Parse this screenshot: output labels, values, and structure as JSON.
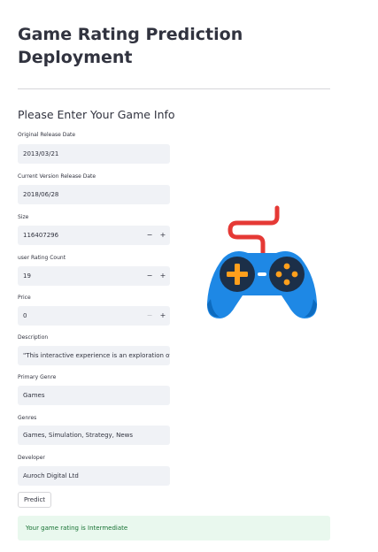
{
  "header": {
    "title": "Game Rating Prediction Deployment",
    "subheader": "Please Enter Your Game Info"
  },
  "form": {
    "original_release_date": {
      "label": "Original Release Date",
      "value": "2013/03/21"
    },
    "current_version_release_date": {
      "label": "Current Version Release Date",
      "value": "2018/06/28"
    },
    "size": {
      "label": "Size",
      "value": "116407296",
      "minus": "−",
      "plus": "+"
    },
    "user_rating_count": {
      "label": "user Rating Count",
      "value": "19",
      "minus": "−",
      "plus": "+"
    },
    "price": {
      "label": "Price",
      "value": "0",
      "minus": "−",
      "plus": "+"
    },
    "description": {
      "label": "Description",
      "value": "\"This interactive experience is an exploration of a"
    },
    "primary_genre": {
      "label": "Primary Genre",
      "value": "Games"
    },
    "genres": {
      "label": "Genres",
      "value": "Games, Simulation, Strategy, News"
    },
    "developer": {
      "label": "Developer",
      "value": "Auroch Digital Ltd"
    }
  },
  "predict_button": {
    "label": "Predict"
  },
  "result": {
    "message": "Your game rating is Intermediate"
  },
  "illustration": {
    "icon": "gamepad-icon",
    "colors": {
      "body": "#1e88e5",
      "body_dark": "#0d6bbf",
      "pads": "#1c2f48",
      "accent": "#ff9f1c",
      "cable": "#e53935"
    }
  }
}
